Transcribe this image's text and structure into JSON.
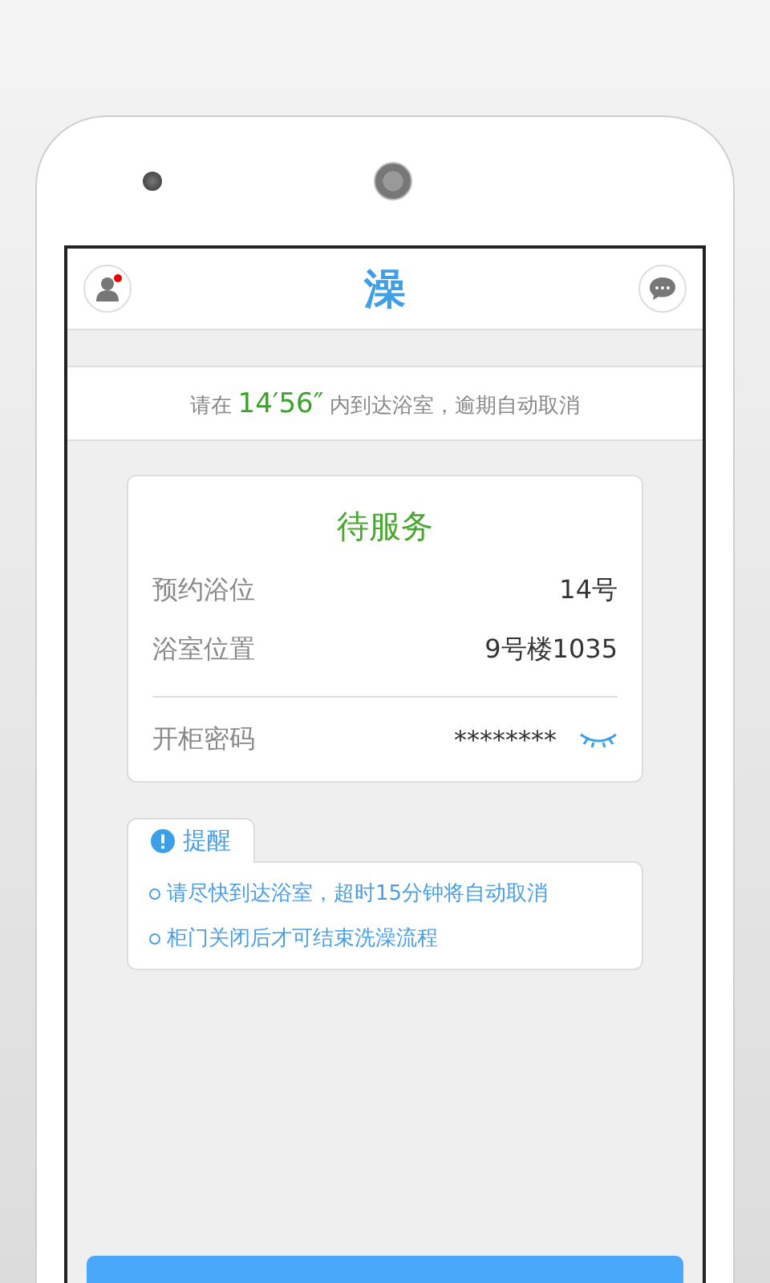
{
  "header": {
    "logo": "澡",
    "profile_badge": true
  },
  "notice": {
    "before": "请在",
    "countdown": "14′56″",
    "after": "内到达浴室，逾期自动取消"
  },
  "order": {
    "status": "待服务",
    "rows": [
      {
        "label": "预约浴位",
        "value": "14号"
      },
      {
        "label": "浴室位置",
        "value": "9号楼1035"
      }
    ],
    "password": {
      "label": "开柜密码",
      "value": "********",
      "visible": false
    }
  },
  "reminder": {
    "title": "提醒",
    "items": [
      "请尽快到达浴室，超时15分钟将自动取消",
      "柜门关闭后才可结束洗澡流程"
    ]
  }
}
